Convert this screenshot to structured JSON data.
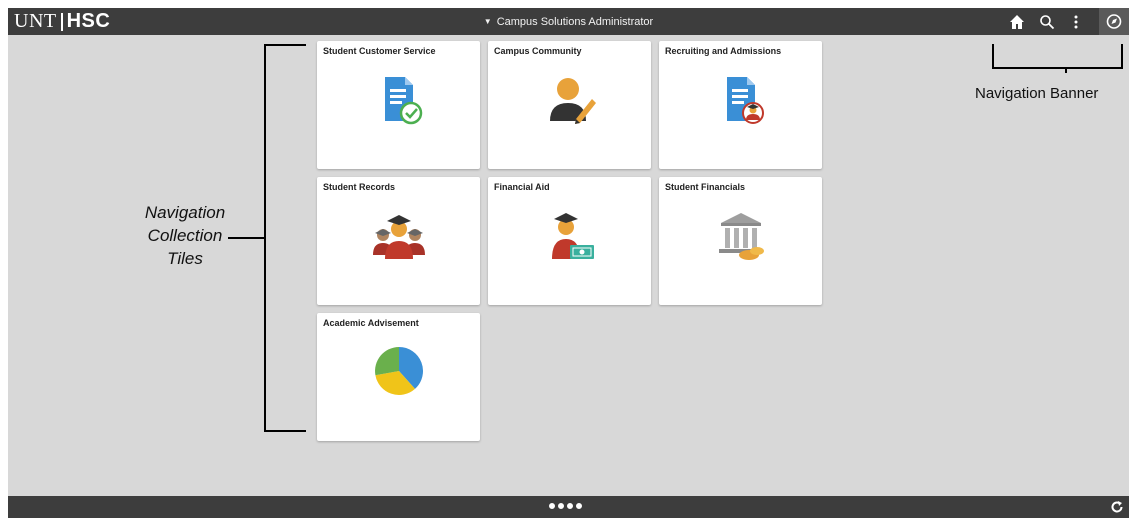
{
  "header": {
    "logo_left": "UNT",
    "logo_right": "HSC",
    "app_title": "Campus Solutions Administrator",
    "icons": [
      "home-icon",
      "search-icon",
      "more-actions-icon",
      "navbar-icon"
    ]
  },
  "tiles": [
    {
      "title": "Student Customer Service",
      "icon": "document-check-icon"
    },
    {
      "title": "Campus Community",
      "icon": "person-pencil-icon"
    },
    {
      "title": "Recruiting and Admissions",
      "icon": "document-person-icon"
    },
    {
      "title": "Student Records",
      "icon": "graduates-group-icon"
    },
    {
      "title": "Financial Aid",
      "icon": "graduate-money-icon"
    },
    {
      "title": "Student Financials",
      "icon": "bank-coins-icon"
    },
    {
      "title": "Academic Advisement",
      "icon": "pie-chart-icon"
    }
  ],
  "footer": {
    "page_dots": 4,
    "active_dot": 0,
    "refresh_icon": "refresh-icon"
  },
  "callouts": {
    "left_line1": "Navigation",
    "left_line2": "Collection",
    "left_line3": "Tiles",
    "right": "Navigation Banner"
  },
  "colors": {
    "banner": "#3d3d3d",
    "background": "#d8d8d8",
    "tile": "#ffffff",
    "accent_blue": "#3a8fd6",
    "accent_orange": "#e8a23a",
    "accent_red": "#c0392b"
  }
}
